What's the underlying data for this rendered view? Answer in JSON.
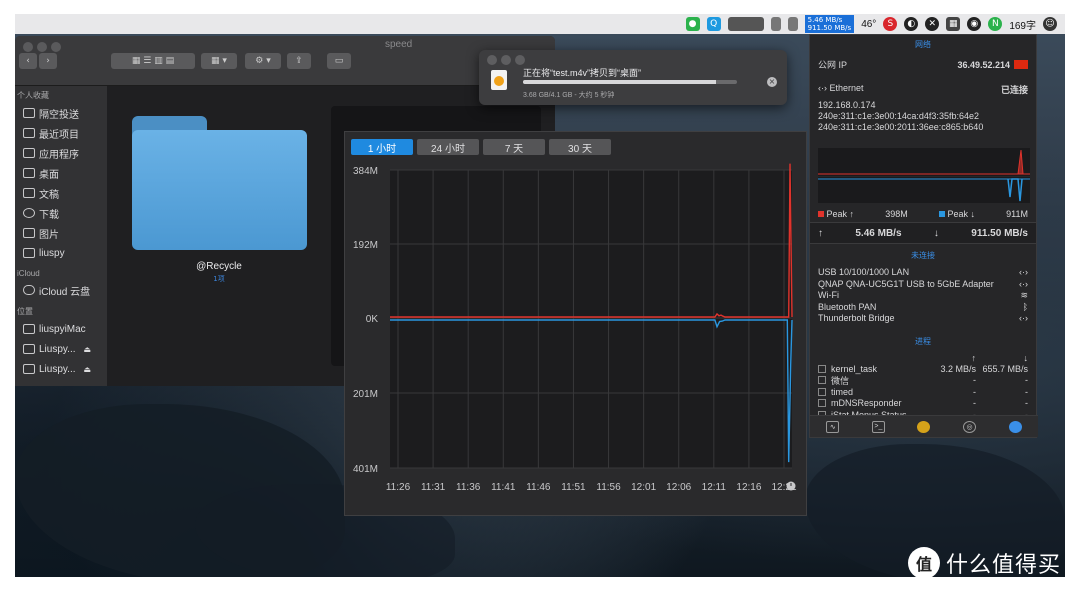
{
  "menubar": {
    "net_up": "5.46 MB/s",
    "net_down": "911.50 MB/s",
    "temperature": "46°",
    "word_count": "169字"
  },
  "finder": {
    "title": "speed",
    "sidebar": {
      "favorites_header": "个人收藏",
      "favorites": [
        "隔空投送",
        "最近项目",
        "应用程序",
        "桌面",
        "文稿",
        "下载",
        "图片",
        "liuspy"
      ],
      "icloud_header": "iCloud",
      "icloud": [
        "iCloud 云盘"
      ],
      "locations_header": "位置",
      "locations": [
        "liuspyiMac",
        "Liuspy...",
        "Liuspy..."
      ]
    },
    "folder": {
      "name": "@Recycle",
      "count": "1项"
    }
  },
  "copy_dialog": {
    "title": "正在将“test.m4v”拷贝到“桌面”",
    "progress": 0.9,
    "status": "3.68 GB/4.1 GB - 大约 5 秒钟"
  },
  "chart_data": {
    "type": "line",
    "range_tabs": [
      "1 小时",
      "24 小时",
      "7 天",
      "30 天"
    ],
    "active_tab": "1 小时",
    "y_ticks_upload": [
      "384M",
      "192M",
      "0K"
    ],
    "y_ticks_download": [
      "201M",
      "401M"
    ],
    "x_ticks": [
      "11:26",
      "11:31",
      "11:36",
      "11:41",
      "11:46",
      "11:51",
      "11:56",
      "12:01",
      "12:06",
      "12:11",
      "12:16",
      "12:21"
    ],
    "ylim_upload_mb": [
      0,
      384
    ],
    "ylim_download_mb": [
      0,
      401
    ],
    "series": [
      {
        "color": "#e0332c",
        "direction": "up",
        "x_minutes": [
          0,
          30,
          48.5,
          48.8,
          49.1,
          49.4,
          49.7,
          50.0,
          55,
          59.5,
          59.7,
          60
        ],
        "values": [
          0,
          0,
          0,
          8,
          3,
          5,
          2,
          0,
          0,
          0,
          398,
          0
        ]
      },
      {
        "color": "#2a97e0",
        "direction": "down",
        "x_minutes": [
          0,
          30,
          48.5,
          48.8,
          49.2,
          49.6,
          50.0,
          55,
          59.3,
          59.5,
          59.8,
          60
        ],
        "values": [
          0,
          0,
          0,
          18,
          4,
          3,
          0,
          0,
          0,
          380,
          120,
          0
        ]
      }
    ],
    "grid": true,
    "clock_icon": "clock-icon"
  },
  "istat": {
    "network_header": "网络",
    "public_ip_label": "公网 IP",
    "public_ip": "36.49.52.214",
    "ethernet_label": "Ethernet",
    "ethernet_status": "已连接",
    "local_ip": "192.168.0.174",
    "ipv6_1": "240e:311:c1e:3e00:14ca:d4f3:35fb:64e2",
    "ipv6_2": "240e:311:c1e:3e00:2011:36ee:c865:b640",
    "peak_up_label": "Peak ↑",
    "peak_up": "398M",
    "peak_down_label": "Peak ↓",
    "peak_down": "911M",
    "rate_up": "5.46 MB/s",
    "rate_down": "911.50 MB/s",
    "not_connected_header": "未连接",
    "interfaces": [
      "USB 10/100/1000 LAN",
      "QNAP QNA-UC5G1T USB to 5GbE Adapter",
      "Wi-Fi",
      "Bluetooth PAN",
      "Thunderbolt Bridge"
    ],
    "process_header": "进程",
    "processes": [
      {
        "name": "kernel_task",
        "up": "3.2 MB/s",
        "down": "655.7 MB/s"
      },
      {
        "name": "微信",
        "up": "-",
        "down": "-"
      },
      {
        "name": "timed",
        "up": "-",
        "down": "-"
      },
      {
        "name": "mDNSResponder",
        "up": "-",
        "down": "-"
      },
      {
        "name": "iStat Menus Status",
        "up": "-",
        "down": "-"
      }
    ],
    "colors": {
      "accent": "#3a8fe8",
      "upload": "#e0332c",
      "download": "#2a97e0"
    }
  },
  "watermark": {
    "logo": "值",
    "text": "什么值得买"
  }
}
